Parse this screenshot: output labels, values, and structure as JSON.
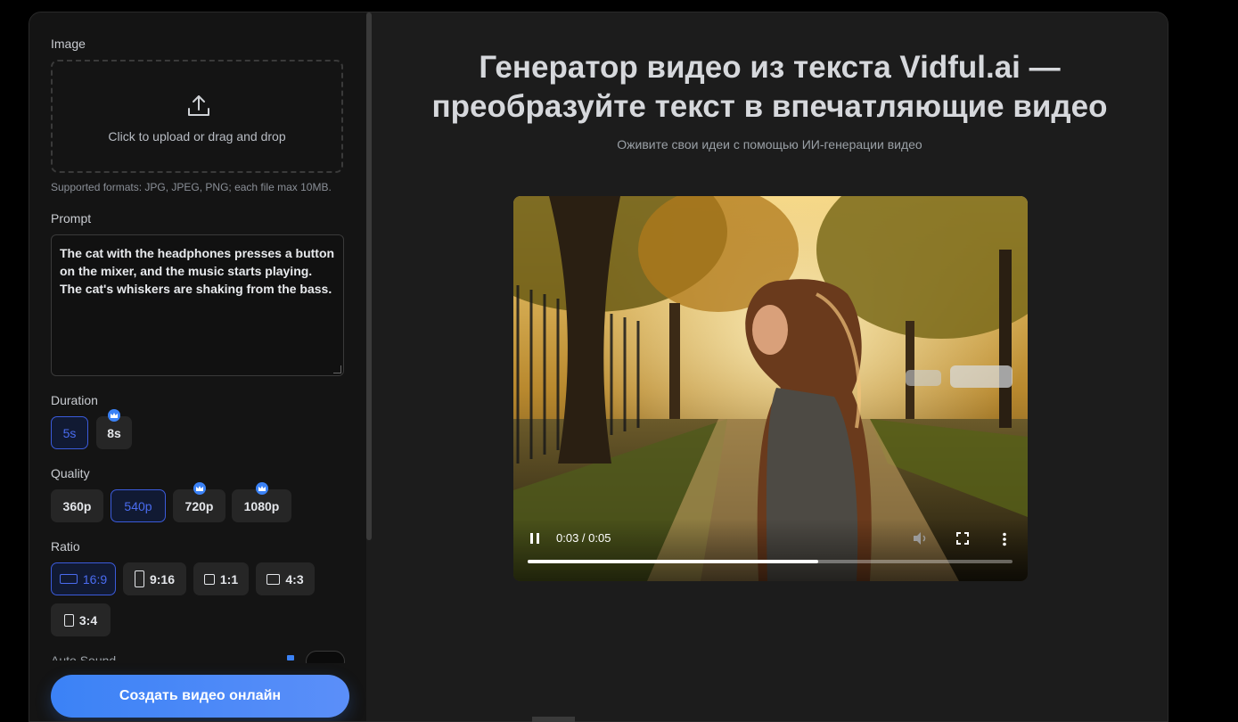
{
  "sidebar": {
    "image_label": "Image",
    "upload_text": "Click to upload or drag and drop",
    "formats_hint": "Supported formats: JPG, JPEG, PNG; each file max 10MB.",
    "prompt_label": "Prompt",
    "prompt_value": "The cat with the headphones presses a button on the mixer, and the music starts playing. The cat's whiskers are shaking from the bass.",
    "duration_label": "Duration",
    "duration_options": [
      {
        "label": "5s",
        "selected": true,
        "premium": false
      },
      {
        "label": "8s",
        "selected": false,
        "premium": true
      }
    ],
    "quality_label": "Quality",
    "quality_options": [
      {
        "label": "360p",
        "selected": false,
        "premium": false
      },
      {
        "label": "540p",
        "selected": true,
        "premium": false
      },
      {
        "label": "720p",
        "selected": false,
        "premium": true
      },
      {
        "label": "1080p",
        "selected": false,
        "premium": true
      }
    ],
    "ratio_label": "Ratio",
    "ratio_options": [
      {
        "label": "16:9",
        "selected": true
      },
      {
        "label": "9:16",
        "selected": false
      },
      {
        "label": "1:1",
        "selected": false
      },
      {
        "label": "4:3",
        "selected": false
      },
      {
        "label": "3:4",
        "selected": false
      }
    ],
    "auto_sound_label": "Auto Sound",
    "cta_label": "Создать видео онлайн"
  },
  "main": {
    "title_line1": "Генератор видео из текста Vidful.ai —",
    "title_line2": "преобразуйте текст в впечатляющие видео",
    "subtitle": "Оживите свои идеи с помощью ИИ-генерации видео",
    "video": {
      "time": "0:03 / 0:05",
      "progress": 0.6
    }
  },
  "colors": {
    "accent": "#3b82f6",
    "selected_border": "#3b5bdb",
    "panel_bg": "#141414",
    "main_bg": "#1c1c1c"
  }
}
